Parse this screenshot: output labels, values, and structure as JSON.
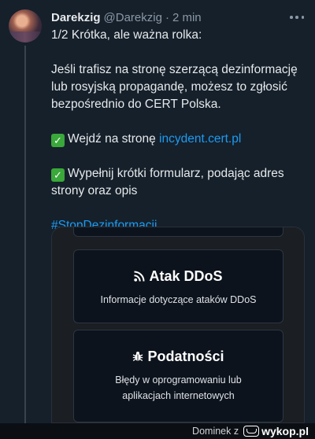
{
  "tweet": {
    "author_name": "Darekzig",
    "handle": "@Darekzig",
    "separator": "·",
    "time": "2 min",
    "line1": "1/2 Krótka, ale ważna rolka:",
    "line2": "Jeśli trafisz na stronę szerzącą dezinformację lub rosyjską propagandę, możesz to zgłosić bezpośrednio do CERT Polska.",
    "line3_prefix": "Wejdź na stronę ",
    "line3_link": "incydent.cert.pl",
    "line4": "Wypełnij krótki formularz, podając adres strony oraz opis",
    "hashtag": "#StopDezinformacji",
    "check_icon": "✓"
  },
  "media": {
    "card_ddos": {
      "title": "Atak DDoS",
      "description": "Informacje dotyczące ataków DDoS",
      "icon": "rss-icon"
    },
    "card_vuln": {
      "title": "Podatności",
      "description": "Błędy w oprogramowaniu lub aplikacjach internetowych",
      "icon": "bug-icon"
    }
  },
  "footer": {
    "credit": "Dominek z",
    "site": "wykop.pl"
  },
  "colors": {
    "background": "#15202b",
    "link": "#1d9bf0",
    "muted": "#8b98a5"
  }
}
